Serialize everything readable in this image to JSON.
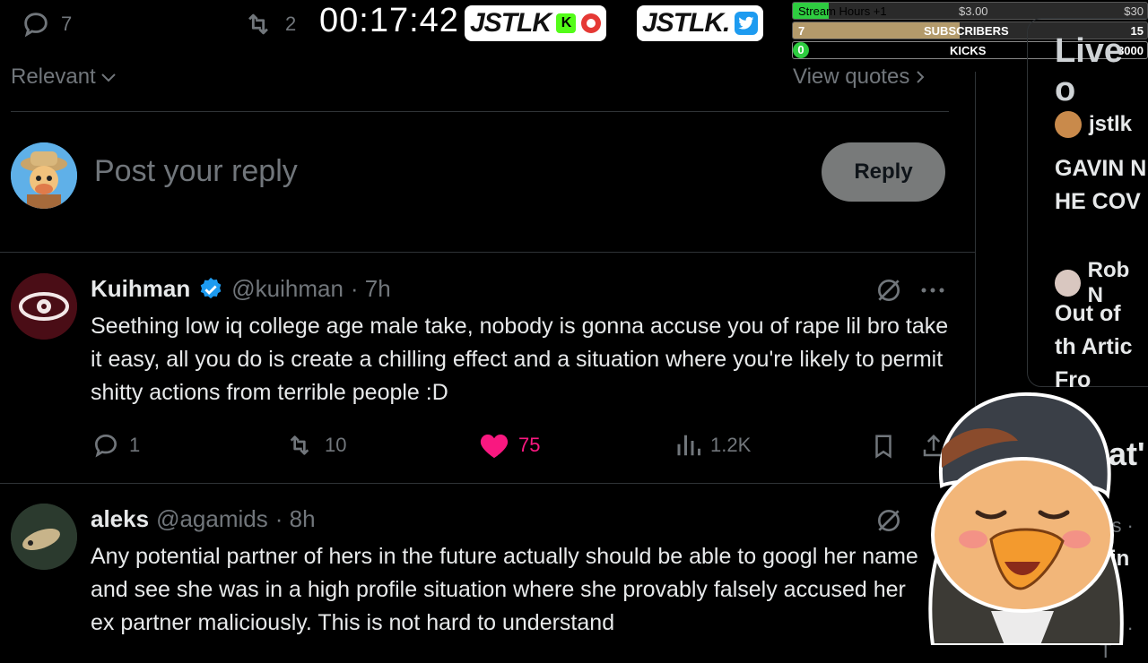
{
  "top": {
    "replies_count": "7",
    "reposts_count": "2",
    "timer": "00:17:42",
    "brand1": "JSTLK",
    "brand1_k": "K",
    "brand2": "JSTLK.",
    "overlay": {
      "stream_hours_label": "Stream Hours +1",
      "stream_hours_amount": "$3.00",
      "stream_hours_max": "$30",
      "subs_count": "7",
      "subs_label": "SUBSCRIBERS",
      "subs_goal": "15",
      "kicks_count": "0",
      "kicks_label": "KICKS",
      "kicks_goal": "3000"
    }
  },
  "sort": {
    "label": "Relevant",
    "view_quotes": "View quotes"
  },
  "composer": {
    "placeholder": "Post your reply",
    "reply_label": "Reply"
  },
  "tweets": [
    {
      "name": "Kuihman",
      "handle": "@kuihman",
      "time": "· 7h",
      "text": "Seething low iq college age male take, nobody is gonna accuse you of rape lil bro take it easy, all you do is create a chilling effect and a situation where you're likely to permit shitty actions from terrible people :D",
      "replies": "1",
      "reposts": "10",
      "likes": "75",
      "views": "1.2K"
    },
    {
      "name": "aleks",
      "handle": "@agamids",
      "time": "· 8h",
      "text": "Any potential partner of hers in the future actually should be able to googl her name and see she was in a high profile situation where she provably falsely accused her ex partner maliciously. This is not hard to understand"
    }
  ],
  "right_panel": {
    "heading": "Live o",
    "items": [
      {
        "name": "jstlk",
        "text": "GAVIN N HE COV"
      },
      {
        "name": "Rob N",
        "text": "Out of th Artic Fro"
      }
    ],
    "partial_heading": "at'",
    "partial_1": "rts · T",
    "partial_2": "in",
    "partial_3": "rts · T"
  },
  "colors": {
    "like": "#f91880",
    "verified": "#1d9bf0",
    "kick_green": "#53fc18"
  }
}
